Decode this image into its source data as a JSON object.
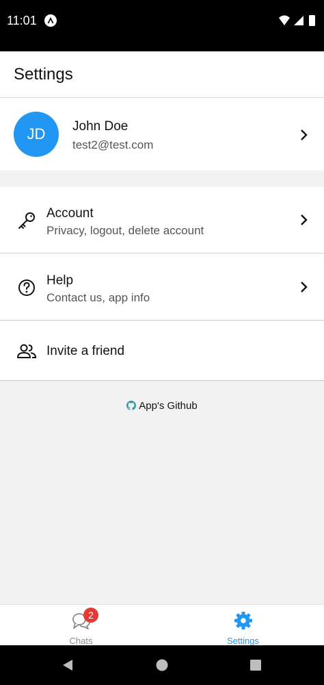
{
  "status_bar": {
    "time": "11:01"
  },
  "header": {
    "title": "Settings"
  },
  "profile": {
    "initials": "JD",
    "name": "John Doe",
    "email": "test2@test.com"
  },
  "menu": {
    "account": {
      "title": "Account",
      "subtitle": "Privacy, logout, delete account",
      "icon": "key-icon"
    },
    "help": {
      "title": "Help",
      "subtitle": "Contact us, app info",
      "icon": "help-circle-icon"
    },
    "invite": {
      "title": "Invite a friend",
      "icon": "people-icon"
    }
  },
  "footer_link": {
    "label": "App's Github",
    "icon": "github-icon"
  },
  "tabs": [
    {
      "label": "Chats",
      "badge": "2",
      "icon": "chat-bubbles-icon",
      "active": false
    },
    {
      "label": "Settings",
      "icon": "gear-icon",
      "active": true
    }
  ],
  "colors": {
    "accent": "#2196f3",
    "badge": "#e53935",
    "background": "#f2f2f2"
  }
}
